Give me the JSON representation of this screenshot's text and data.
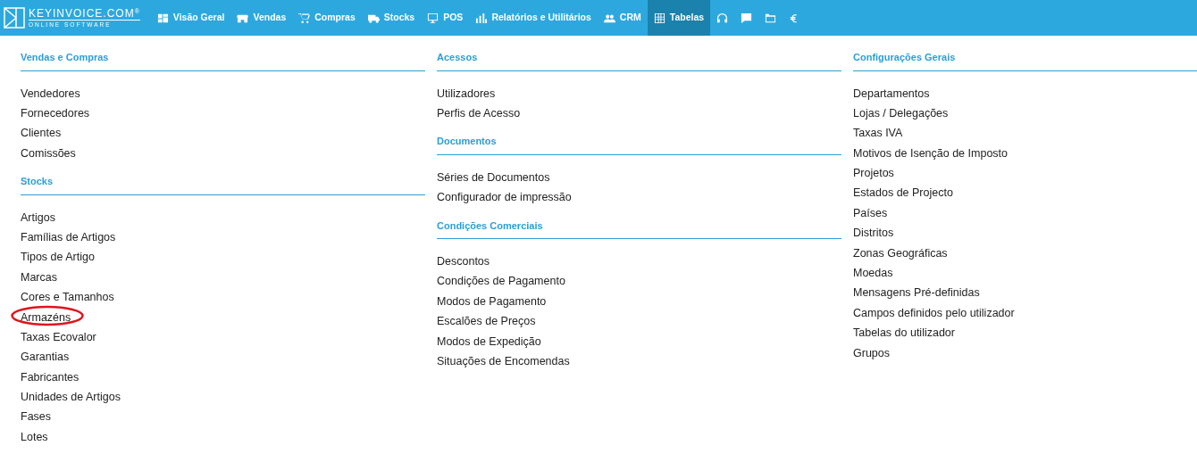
{
  "logo": {
    "name": "KEYINVOICE.COM",
    "registered": "®",
    "tagline": "ONLINE SOFTWARE"
  },
  "nav": [
    {
      "label": "Visão Geral",
      "selected": false
    },
    {
      "label": "Vendas",
      "selected": false
    },
    {
      "label": "Compras",
      "selected": false
    },
    {
      "label": "Stocks",
      "selected": false
    },
    {
      "label": "POS",
      "selected": false
    },
    {
      "label": "Relatórios e Utilitários",
      "selected": false
    },
    {
      "label": "CRM",
      "selected": false
    },
    {
      "label": "Tabelas",
      "selected": true
    }
  ],
  "nav_icons": [
    {
      "selected": false
    },
    {
      "selected": false
    },
    {
      "selected": false
    },
    {
      "selected": false
    }
  ],
  "columns": [
    [
      {
        "title": "Vendas e Compras",
        "items": [
          {
            "label": "Vendedores",
            "highlighted": false
          },
          {
            "label": "Fornecedores",
            "highlighted": false
          },
          {
            "label": "Clientes",
            "highlighted": false
          },
          {
            "label": "Comissões",
            "highlighted": false
          }
        ]
      },
      {
        "title": "Stocks",
        "items": [
          {
            "label": "Artigos",
            "highlighted": false
          },
          {
            "label": "Famílias de Artigos",
            "highlighted": false
          },
          {
            "label": "Tipos de Artigo",
            "highlighted": false
          },
          {
            "label": "Marcas",
            "highlighted": false
          },
          {
            "label": "Cores e Tamanhos",
            "highlighted": false
          },
          {
            "label": "Armazéns",
            "highlighted": true
          },
          {
            "label": "Taxas Ecovalor",
            "highlighted": false
          },
          {
            "label": "Garantias",
            "highlighted": false
          },
          {
            "label": "Fabricantes",
            "highlighted": false
          },
          {
            "label": "Unidades de Artigos",
            "highlighted": false
          },
          {
            "label": "Fases",
            "highlighted": false
          },
          {
            "label": "Lotes",
            "highlighted": false
          }
        ]
      }
    ],
    [
      {
        "title": "Acessos",
        "items": [
          {
            "label": "Utilizadores",
            "highlighted": false
          },
          {
            "label": "Perfis de Acesso",
            "highlighted": false
          }
        ]
      },
      {
        "title": "Documentos",
        "items": [
          {
            "label": "Séries de Documentos",
            "highlighted": false
          },
          {
            "label": "Configurador de impressão",
            "highlighted": false
          }
        ]
      },
      {
        "title": "Condições Comerciais",
        "items": [
          {
            "label": "Descontos",
            "highlighted": false
          },
          {
            "label": "Condições de Pagamento",
            "highlighted": false
          },
          {
            "label": "Modos de Pagamento",
            "highlighted": false
          },
          {
            "label": "Escalões de Preços",
            "highlighted": false
          },
          {
            "label": "Modos de Expedição",
            "highlighted": false
          },
          {
            "label": "Situações de Encomendas",
            "highlighted": false
          }
        ]
      }
    ],
    [
      {
        "title": "Configurações Gerais",
        "items": [
          {
            "label": "Departamentos",
            "highlighted": false
          },
          {
            "label": "Lojas / Delegações",
            "highlighted": false
          },
          {
            "label": "Taxas IVA",
            "highlighted": false
          },
          {
            "label": "Motivos de Isenção de Imposto",
            "highlighted": false
          },
          {
            "label": "Projetos",
            "highlighted": false
          },
          {
            "label": "Estados de Projecto",
            "highlighted": false
          },
          {
            "label": "Países",
            "highlighted": false
          },
          {
            "label": "Distritos",
            "highlighted": false
          },
          {
            "label": "Zonas Geográficas",
            "highlighted": false
          },
          {
            "label": "Moedas",
            "highlighted": false
          },
          {
            "label": "Mensagens Pré-definidas",
            "highlighted": false
          },
          {
            "label": "Campos definidos pelo utilizador",
            "highlighted": false
          },
          {
            "label": "Tabelas do utilizador",
            "highlighted": false
          },
          {
            "label": "Grupos",
            "highlighted": false
          }
        ]
      }
    ]
  ]
}
